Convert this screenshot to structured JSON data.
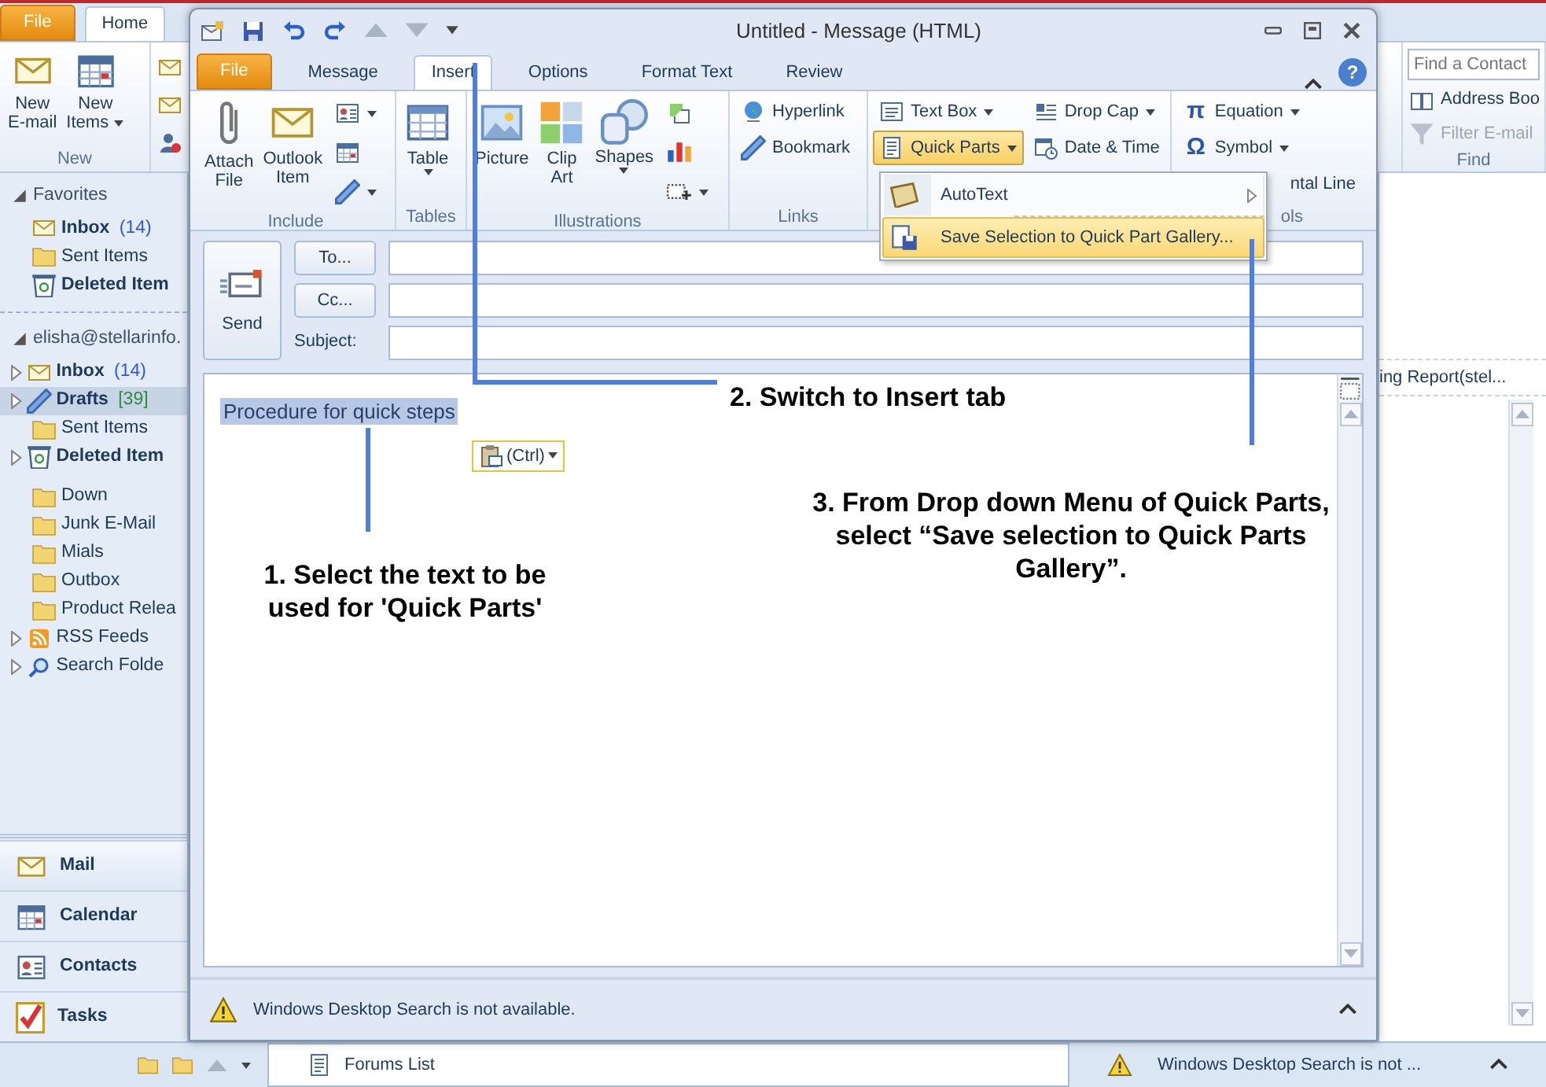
{
  "main_window": {
    "tabs": [
      {
        "label": "File",
        "kind": "file",
        "selected": false
      },
      {
        "label": "Home",
        "kind": "tab",
        "selected": true
      }
    ],
    "ribbon_groups": [
      {
        "label": "New",
        "buttons": [
          {
            "label": "New E-mail",
            "dropdown": false
          },
          {
            "label": "New Items",
            "dropdown": true
          }
        ]
      }
    ],
    "find_group": {
      "label": "Find",
      "search": {
        "placeholder": "Find a Contact"
      },
      "buttons": [
        {
          "label": "Address Boo",
          "disabled": false
        },
        {
          "label": "Filter E-mail",
          "disabled": true
        }
      ]
    },
    "favorites": {
      "label": "Favorites",
      "expanded": true,
      "items": [
        {
          "label": "Inbox",
          "count": "(14)",
          "color": "#3357d6",
          "bold": true,
          "expander": false,
          "selected": false
        },
        {
          "label": "Sent Items",
          "bold": false,
          "expander": false,
          "selected": false
        },
        {
          "label": "Deleted Item",
          "bold": true,
          "expander": false,
          "selected": false
        }
      ]
    },
    "account": {
      "label": "elisha@stellarinfo.",
      "expanded": true,
      "items": [
        {
          "label": "Inbox",
          "count": "(14)",
          "color": "#3357d6",
          "bold": true,
          "expander": true,
          "selected": false
        },
        {
          "label": "Drafts",
          "count": "[39]",
          "color": "#2f8a3a",
          "bold": true,
          "expander": true,
          "selected": true
        },
        {
          "label": "Sent Items",
          "bold": false,
          "expander": false,
          "selected": false
        },
        {
          "label": "Deleted Item",
          "bold": true,
          "expander": true,
          "selected": false
        },
        {
          "label": "Down",
          "bold": false,
          "expander": false,
          "selected": false
        },
        {
          "label": "Junk E-Mail",
          "bold": false,
          "expander": false,
          "selected": false
        },
        {
          "label": "Mials",
          "bold": false,
          "expander": false,
          "selected": false
        },
        {
          "label": "Outbox",
          "bold": false,
          "expander": false,
          "selected": false
        },
        {
          "label": "Product Relea",
          "bold": false,
          "expander": false,
          "selected": false
        },
        {
          "label": "RSS Feeds",
          "bold": false,
          "expander": true,
          "selected": false
        },
        {
          "label": "Search Folde",
          "bold": false,
          "expander": true,
          "selected": false
        }
      ]
    },
    "navigation": [
      {
        "label": "Mail",
        "selected": true
      },
      {
        "label": "Calendar",
        "selected": false
      },
      {
        "label": "Contacts",
        "selected": false
      },
      {
        "label": "Tasks",
        "selected": false
      }
    ],
    "reading_pane": {
      "text": "ing Report(stel..."
    },
    "bottom_bar": {
      "item": "Forums List",
      "status": "Windows Desktop Search is not ..."
    }
  },
  "message_window": {
    "title": "Untitled - Message (HTML)",
    "tabs": [
      {
        "label": "File",
        "kind": "file",
        "selected": false
      },
      {
        "label": "Message",
        "kind": "tab",
        "selected": false
      },
      {
        "label": "Insert",
        "kind": "tab",
        "selected": true
      },
      {
        "label": "Options",
        "kind": "tab",
        "selected": false
      },
      {
        "label": "Format Text",
        "kind": "tab",
        "selected": false
      },
      {
        "label": "Review",
        "kind": "tab",
        "selected": false
      }
    ],
    "help": "?",
    "ribbon_groups": [
      {
        "label": "Include",
        "columns": [
          [
            {
              "kind": "large",
              "label": "Attach File",
              "dropdown": false
            }
          ],
          [
            {
              "kind": "large",
              "label": "Outlook Item",
              "dropdown": false
            }
          ],
          [
            {
              "kind": "icon",
              "dropdown": true
            },
            {
              "kind": "icon",
              "dropdown": false
            },
            {
              "kind": "icon",
              "dropdown": true
            }
          ]
        ]
      },
      {
        "label": "Tables",
        "columns": [
          [
            {
              "kind": "large",
              "label": "Table",
              "dropdown": true
            }
          ]
        ]
      },
      {
        "label": "Illustrations",
        "columns": [
          [
            {
              "kind": "large",
              "label": "Picture",
              "dropdown": false
            }
          ],
          [
            {
              "kind": "large",
              "label": "Clip Art",
              "dropdown": false
            }
          ],
          [
            {
              "kind": "large",
              "label": "Shapes",
              "dropdown": true
            }
          ],
          [
            {
              "kind": "icon",
              "dropdown": false
            },
            {
              "kind": "icon",
              "dropdown": false
            },
            {
              "kind": "icon",
              "dropdown": true
            }
          ]
        ]
      },
      {
        "label": "Links",
        "columns": [
          [
            {
              "kind": "small",
              "label": "Hyperlink",
              "dropdown": false
            },
            {
              "kind": "small",
              "label": "Bookmark",
              "dropdown": false
            }
          ]
        ]
      },
      {
        "columns": [
          [
            {
              "kind": "small",
              "label": "Text Box",
              "dropdown": true,
              "pressed": false
            },
            {
              "kind": "small",
              "label": "Quick Parts",
              "dropdown": true,
              "pressed": true
            }
          ],
          [
            {
              "kind": "small",
              "label": "Drop Cap",
              "dropdown": true,
              "pressed": false
            },
            {
              "kind": "small",
              "label": "Date & Time",
              "dropdown": false,
              "pressed": false
            }
          ]
        ]
      },
      {
        "label": "ols",
        "columns": [
          [
            {
              "kind": "small",
              "glyph": "π",
              "label": "Equation",
              "dropdown": true
            },
            {
              "kind": "small",
              "glyph": "Ω",
              "label": "Symbol",
              "dropdown": true
            },
            {
              "kind": "small",
              "label": "ntal Line",
              "dropdown": false
            }
          ]
        ]
      }
    ],
    "menu": [
      {
        "label": "AutoText",
        "submenu": true,
        "selected": false
      },
      {
        "label": "Save Selection to Quick Part Gallery...",
        "submenu": false,
        "selected": true
      }
    ],
    "send": "Send",
    "fields": [
      {
        "label": "To...",
        "kind": "button"
      },
      {
        "label": "Cc...",
        "kind": "button"
      },
      {
        "label": "Subject:",
        "kind": "label"
      }
    ],
    "body": {
      "text": "Procedure for quick steps",
      "selected": true,
      "paste_options": "(Ctrl)"
    },
    "status": "Windows Desktop Search is not available."
  },
  "annotations": [
    {
      "text": "1. Select the text to be used for 'Quick Parts'"
    },
    {
      "text": "2. Switch to Insert tab"
    },
    {
      "text": "3. From Drop down Menu of Quick Parts, select “Save selection to Quick Parts Gallery”."
    }
  ]
}
